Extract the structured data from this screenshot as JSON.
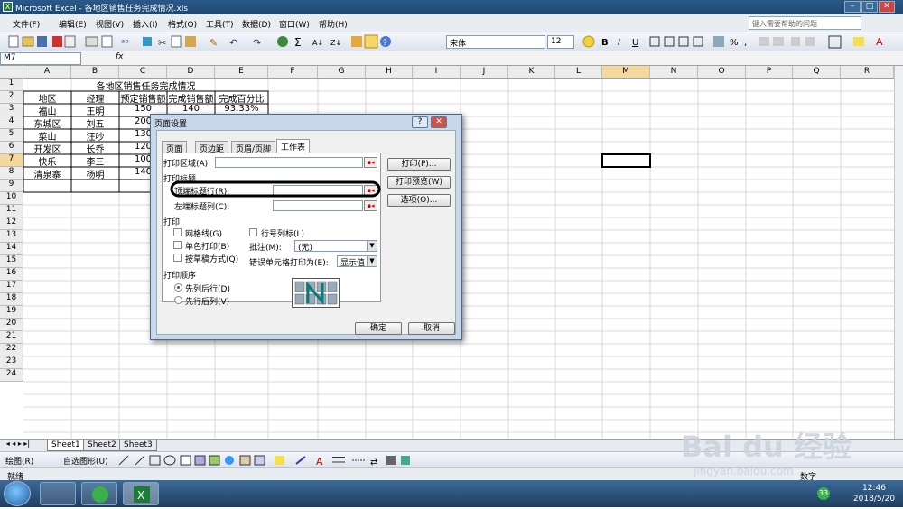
{
  "window": {
    "title": "Microsoft Excel - 各地区销售任务完成情况.xls"
  },
  "menubar": {
    "items": [
      "文件(F)",
      "编辑(E)",
      "视图(V)",
      "插入(I)",
      "格式(O)",
      "工具(T)",
      "数据(D)",
      "窗口(W)",
      "帮助(H)"
    ],
    "help_placeholder": "键入需要帮助的问题"
  },
  "toolbar": {
    "font": "宋体",
    "size": "12"
  },
  "formula_bar": {
    "namebox": "M7",
    "fx": "fx"
  },
  "columns": [
    "A",
    "B",
    "C",
    "D",
    "E",
    "F",
    "G",
    "H",
    "I",
    "J",
    "K",
    "L",
    "M",
    "N",
    "O",
    "P",
    "Q",
    "R"
  ],
  "rows": [
    "1",
    "2",
    "3",
    "4",
    "5",
    "6",
    "7",
    "8",
    "9",
    "10",
    "11",
    "12",
    "13",
    "14",
    "15",
    "16",
    "17",
    "18",
    "19",
    "20",
    "21",
    "22",
    "23",
    "24"
  ],
  "sheet": {
    "title": "各地区销售任务完成情况",
    "headers": [
      "地区",
      "经理",
      "预定销售额",
      "完成销售额",
      "完成百分比"
    ],
    "data": [
      [
        "福山",
        "王明",
        "150",
        "140",
        "93.33%"
      ],
      [
        "东城区",
        "刘五",
        "200",
        "",
        ""
      ],
      [
        "菜山",
        "汪吵",
        "130",
        "",
        ""
      ],
      [
        "开发区",
        "长乔",
        "120",
        "",
        ""
      ],
      [
        "快乐",
        "李三",
        "100",
        "",
        ""
      ],
      [
        "清泉寨",
        "杨明",
        "140",
        "",
        ""
      ]
    ]
  },
  "sheet_tabs": [
    "Sheet1",
    "Sheet2",
    "Sheet3"
  ],
  "drawbar": {
    "draw": "绘图(R)",
    "autoshape": "自选图形(U)"
  },
  "status": {
    "left": "就绪",
    "right": "数字"
  },
  "taskbar": {
    "time": "12:46",
    "date": "2018/5/20",
    "badge": "33"
  },
  "dialog": {
    "title": "页面设置",
    "tabs": [
      "页面",
      "页边距",
      "页眉/页脚",
      "工作表"
    ],
    "print_area": "打印区域(A):",
    "print_titles": "打印标题",
    "top_rows": "顶端标题行(R):",
    "left_cols": "左端标题列(C):",
    "print_section": "打印",
    "gridlines": "网格线(G)",
    "mono": "单色打印(B)",
    "draft": "按草稿方式(Q)",
    "rowcol": "行号列标(L)",
    "comments_label": "批注(M):",
    "comments_value": "(无)",
    "errors_label": "错误单元格打印为(E):",
    "errors_value": "显示值",
    "order_section": "打印顺序",
    "down_then_over": "先列后行(D)",
    "over_then_down": "先行后列(V)",
    "btn_print": "打印(P)...",
    "btn_preview": "打印预览(W)",
    "btn_options": "选项(O)...",
    "btn_ok": "确定",
    "btn_cancel": "取消"
  },
  "watermark": {
    "brand": "Bai du 经验",
    "url": "jingyan.baidu.com"
  }
}
